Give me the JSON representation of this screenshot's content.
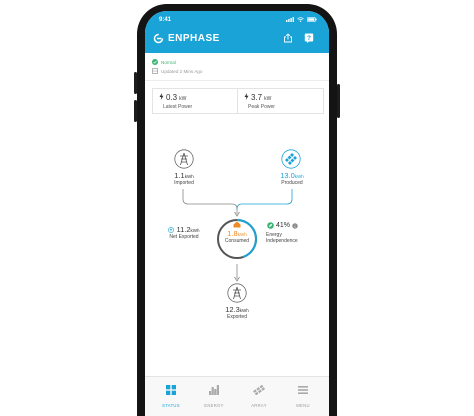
{
  "statusbar": {
    "time": "9:41"
  },
  "header": {
    "brand": "ENPHASE",
    "share_icon": "share-icon",
    "help_icon": "help-icon",
    "color": "#1aa3d6"
  },
  "system_status": {
    "state": "Normal",
    "updated": "Updated 2 Mins Ago",
    "state_color": "#3cb371"
  },
  "cards": [
    {
      "value": "0.3",
      "unit": "kW",
      "label": "Latest Power"
    },
    {
      "value": "3.7",
      "unit": "kW",
      "label": "Peak Power"
    }
  ],
  "flow": {
    "imported": {
      "value": "1.1",
      "unit": "kWh",
      "label": "Imported"
    },
    "produced": {
      "value": "13.0",
      "unit": "kWh",
      "label": "Produced"
    },
    "net_exported": {
      "value": "11.2",
      "unit": "kWh",
      "label": "Net Exported"
    },
    "consumed": {
      "value": "1.8",
      "unit": "kWh",
      "label": "Consumed"
    },
    "independence": {
      "value": "41%",
      "label_line1": "Energy",
      "label_line2": "Independence",
      "info_icon": "info-icon"
    },
    "exported": {
      "value": "12.3",
      "unit": "kWh",
      "label": "Exported"
    }
  },
  "tabs": [
    {
      "label": "STATUS",
      "icon": "status-grid-icon",
      "active": true
    },
    {
      "label": "ENERGY",
      "icon": "bar-chart-icon",
      "active": false
    },
    {
      "label": "ARRAY",
      "icon": "solar-array-icon",
      "active": false
    },
    {
      "label": "MENU",
      "icon": "menu-icon",
      "active": false
    }
  ],
  "colors": {
    "accent": "#1aa3d6",
    "consumed": "#f08a24",
    "green": "#3cb371"
  }
}
